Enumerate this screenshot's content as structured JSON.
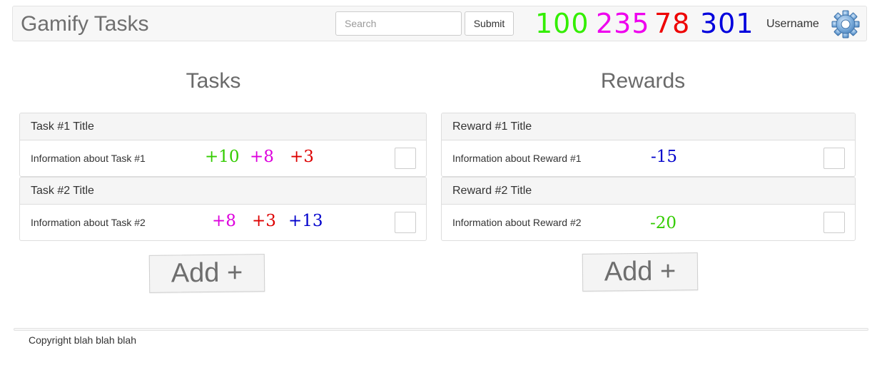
{
  "app": {
    "brand": "Gamify Tasks"
  },
  "search": {
    "placeholder": "Search",
    "value": ""
  },
  "submit_label": "Submit",
  "scores": [
    {
      "value": "100",
      "color": "#33ee00"
    },
    {
      "value": "235",
      "color": "#ee00ee"
    },
    {
      "value": "78",
      "color": "#ee0000"
    },
    {
      "value": "301",
      "color": "#0000dd"
    }
  ],
  "user": {
    "name": "Username",
    "settings_icon": "gear-icon"
  },
  "tasks": {
    "title": "Tasks",
    "items": [
      {
        "title": "Task #1 Title",
        "info": "Information about Task #1",
        "points": [
          {
            "text": "+10",
            "color": "#33cc00"
          },
          {
            "text": "+8",
            "color": "#dd00dd"
          },
          {
            "text": "+3",
            "color": "#dd0000"
          }
        ]
      },
      {
        "title": "Task #2 Title",
        "info": "Information about Task #2",
        "points": [
          {
            "text": "+8",
            "color": "#dd00dd"
          },
          {
            "text": "+3",
            "color": "#dd0000"
          },
          {
            "text": "+13",
            "color": "#0000cc"
          }
        ]
      }
    ],
    "add_label": "Add +"
  },
  "rewards": {
    "title": "Rewards",
    "items": [
      {
        "title": "Reward #1 Title",
        "info": "Information about Reward #1",
        "points": [
          {
            "text": "-15",
            "color": "#0000cc"
          }
        ]
      },
      {
        "title": "Reward #2 Title",
        "info": "Information about Reward #2",
        "points": [
          {
            "text": "-20",
            "color": "#33cc00"
          }
        ]
      }
    ],
    "add_label": "Add +"
  },
  "footer": {
    "copyright": "Copyright blah blah blah"
  }
}
